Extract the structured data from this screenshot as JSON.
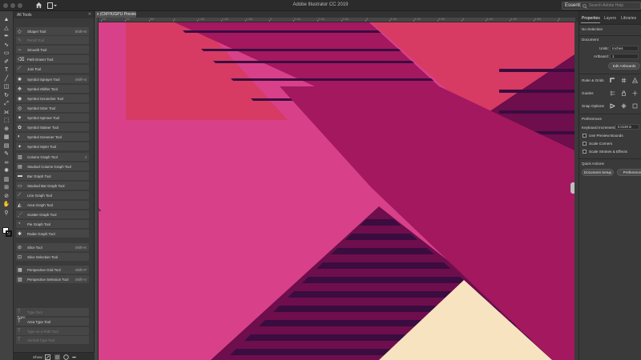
{
  "window": {
    "title": "Adobe Illustrator CC 2019",
    "workspace": "Essentials",
    "search_placeholder": "Search Adobe Help"
  },
  "document": {
    "tab_label": "x (CMYK/GPU Preview)"
  },
  "ruler": {
    "labels": [
      "1/4",
      "1/2",
      "3/4",
      "1",
      "1 1/4",
      "1 1/2",
      "1 3/4",
      "2",
      "2 1/4",
      "2 1/2",
      "2 3/4",
      "3",
      "3 1/4",
      "3 1/2",
      "3 3/4",
      "4",
      "4 1/4",
      "4 1/2",
      "4 3/4",
      "5"
    ]
  },
  "flyout": {
    "header": "All Tools",
    "type_section": "Type:",
    "show_label": "Show:",
    "tools": [
      {
        "name": "Shaper Tool",
        "shortcut": "Shift+N",
        "dim": false
      },
      {
        "name": "Pencil Tool",
        "shortcut": "",
        "dim": true
      },
      {
        "name": "Smooth Tool",
        "shortcut": "",
        "dim": false
      },
      {
        "name": "Path Eraser Tool",
        "shortcut": "",
        "dim": false
      },
      {
        "name": "Join Tool",
        "shortcut": "",
        "dim": false
      },
      {
        "name": "Symbol Sprayer Tool",
        "shortcut": "Shift+S",
        "dim": false
      },
      {
        "name": "Symbol Shifter Tool",
        "shortcut": "",
        "dim": false
      },
      {
        "name": "Symbol Scruncher Tool",
        "shortcut": "",
        "dim": false
      },
      {
        "name": "Symbol Sizer Tool",
        "shortcut": "",
        "dim": false
      },
      {
        "name": "Symbol Spinner Tool",
        "shortcut": "",
        "dim": false
      },
      {
        "name": "Symbol Stainer Tool",
        "shortcut": "",
        "dim": false
      },
      {
        "name": "Symbol Screener Tool",
        "shortcut": "",
        "dim": false
      },
      {
        "name": "Symbol Styler Tool",
        "shortcut": "",
        "dim": false
      },
      {
        "name": "Column Graph Tool",
        "shortcut": "J",
        "dim": false
      },
      {
        "name": "Stacked Column Graph Tool",
        "shortcut": "",
        "dim": false
      },
      {
        "name": "Bar Graph Tool",
        "shortcut": "",
        "dim": false
      },
      {
        "name": "Stacked Bar Graph Tool",
        "shortcut": "",
        "dim": false
      },
      {
        "name": "Line Graph Tool",
        "shortcut": "",
        "dim": false
      },
      {
        "name": "Area Graph Tool",
        "shortcut": "",
        "dim": false
      },
      {
        "name": "Scatter Graph Tool",
        "shortcut": "",
        "dim": false
      },
      {
        "name": "Pie Graph Tool",
        "shortcut": "",
        "dim": false
      },
      {
        "name": "Radar Graph Tool",
        "shortcut": "",
        "dim": false
      },
      {
        "name": "Slice Tool",
        "shortcut": "Shift+K",
        "dim": false
      },
      {
        "name": "Slice Selection Tool",
        "shortcut": "",
        "dim": false
      },
      {
        "name": "Perspective Grid Tool",
        "shortcut": "Shift+P",
        "dim": false
      },
      {
        "name": "Perspective Selection Tool",
        "shortcut": "Shift+V",
        "dim": false
      },
      {
        "name": "Type Tool",
        "shortcut": "",
        "dim": true
      },
      {
        "name": "Area Type Tool",
        "shortcut": "",
        "dim": false
      },
      {
        "name": "Type on a Path Tool",
        "shortcut": "",
        "dim": true
      },
      {
        "name": "Vertical Type Tool",
        "shortcut": "",
        "dim": true
      }
    ]
  },
  "panel": {
    "tabs": [
      "Properties",
      "Layers",
      "Libraries"
    ],
    "selection": "No Selection",
    "document_heading": "Document",
    "units_label": "Units:",
    "units_value": "Inches",
    "artboard_label": "Artboard:",
    "artboard_value": "1",
    "edit_artboards": "Edit Artboards",
    "rulers_grids": "Ruler & Grids",
    "guides": "Guides",
    "snap_options": "Snap Options",
    "preferences_heading": "Preferences",
    "keyboard_increment_label": "Keyboard Increment:",
    "keyboard_increment_value": "0.0139 in",
    "use_preview_bounds": "Use Preview Bounds",
    "scale_corners": "Scale Corners",
    "scale_strokes": "Scale Strokes & Effects",
    "quick_actions": "Quick Actions",
    "document_setup": "Document Setup",
    "preferences_button": "Preferences"
  },
  "colors": {
    "canvas_pink": "#d9408a",
    "band_magenta": "#a3185f",
    "rose": "#d73a63",
    "plum": "#6e0e4c",
    "stripe_dark": "#3a0c40",
    "cream": "#f7e3c0"
  }
}
